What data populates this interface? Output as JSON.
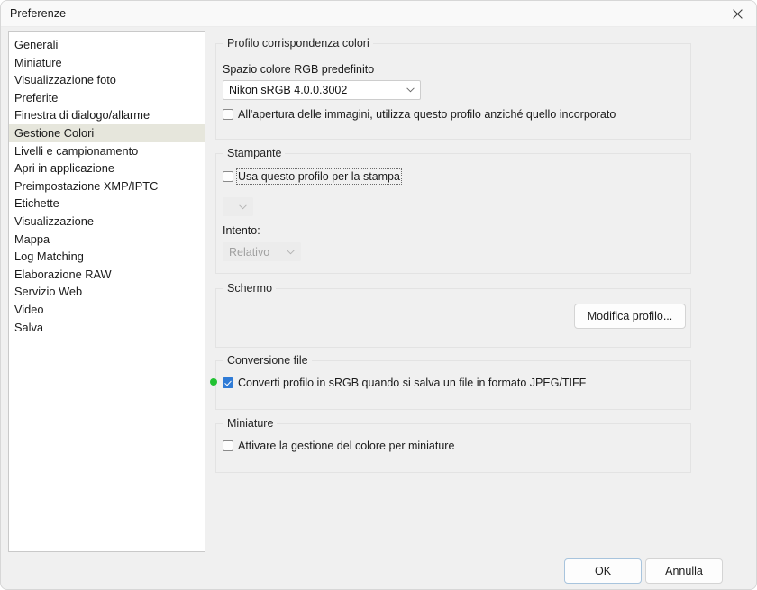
{
  "window": {
    "title": "Preferenze",
    "close_icon": "close-icon",
    "background_color": "#f0f0f0",
    "accent_color": "#2f7bd6",
    "marker_color": "#22c233",
    "selection_color": "#e6e6dc"
  },
  "sidebar": {
    "items": [
      {
        "label": "Generali",
        "selected": false
      },
      {
        "label": "Miniature",
        "selected": false
      },
      {
        "label": "Visualizzazione foto",
        "selected": false
      },
      {
        "label": "Preferite",
        "selected": false
      },
      {
        "label": "Finestra di dialogo/allarme",
        "selected": false
      },
      {
        "label": "Gestione Colori",
        "selected": true
      },
      {
        "label": "Livelli e campionamento",
        "selected": false
      },
      {
        "label": "Apri in applicazione",
        "selected": false
      },
      {
        "label": "Preimpostazione XMP/IPTC",
        "selected": false
      },
      {
        "label": "Etichette",
        "selected": false
      },
      {
        "label": "Visualizzazione",
        "selected": false
      },
      {
        "label": "Mappa",
        "selected": false
      },
      {
        "label": "Log Matching",
        "selected": false
      },
      {
        "label": "Elaborazione RAW",
        "selected": false
      },
      {
        "label": "Servizio Web",
        "selected": false
      },
      {
        "label": "Video",
        "selected": false
      },
      {
        "label": "Salva",
        "selected": false
      }
    ]
  },
  "panel": {
    "profile_group": {
      "legend": "Profilo corrispondenza colori",
      "rgb_space_label": "Spazio colore RGB predefinito",
      "rgb_space_value": "Nikon sRGB 4.0.0.3002",
      "use_profile_checkbox": {
        "label": "All'apertura delle immagini, utilizza questo profilo anziché quello incorporato",
        "checked": false
      }
    },
    "printer_group": {
      "legend": "Stampante",
      "use_profile_checkbox": {
        "label": "Usa questo profilo per la stampa",
        "checked": false,
        "focused": true
      },
      "printer_profile_value": "",
      "intent_label": "Intento:",
      "intent_value": "Relativo"
    },
    "screen_group": {
      "legend": "Schermo",
      "edit_profile_button": "Modifica profilo..."
    },
    "conversion_group": {
      "legend": "Conversione file",
      "convert_checkbox": {
        "label": "Converti profilo in sRGB quando si salva un file in formato JPEG/TIFF",
        "checked": true,
        "marker": true
      }
    },
    "thumbnails_group": {
      "legend": "Miniature",
      "enable_checkbox": {
        "label": "Attivare la gestione del colore per miniature",
        "checked": false
      }
    }
  },
  "footer": {
    "ok_button": {
      "prefix": "",
      "accel": "O",
      "suffix": "K"
    },
    "cancel_button": {
      "prefix": "",
      "accel": "A",
      "suffix": "nnulla"
    }
  }
}
